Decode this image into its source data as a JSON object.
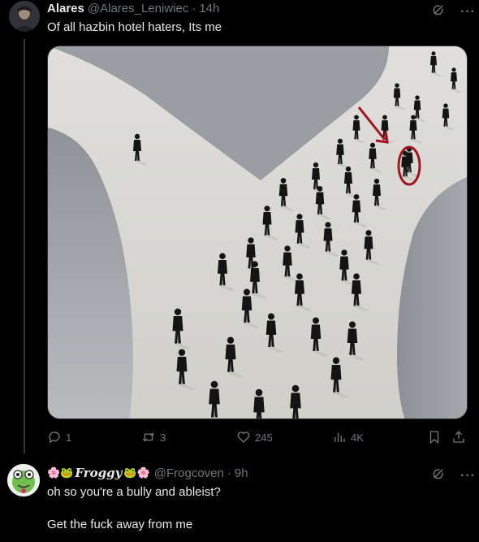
{
  "tweet1": {
    "display_name": "Alares",
    "handle": "@Alares_Leniwiec",
    "separator": "·",
    "time": "14h",
    "text": "Of all hazbin hotel haters, Its me",
    "icons": [
      "grok-icon",
      "more-icon"
    ],
    "more_label": "···",
    "stats": {
      "replies": "1",
      "reposts": "3",
      "likes": "245",
      "views": "4K"
    }
  },
  "tweet2": {
    "emoji_prefix": "🌸🐸",
    "display_name": "Froggy",
    "emoji_suffix": "🐸🌸",
    "handle": "@Frogcoven",
    "separator": "·",
    "time": "9h",
    "more_label": "···",
    "line1": "oh so you're a bully and ableist?",
    "line2": "Get the fuck away from me"
  },
  "colors": {
    "background": "#000000",
    "text": "#e7e9ea",
    "muted": "#71767b",
    "annotation_red": "#a3121f"
  }
}
